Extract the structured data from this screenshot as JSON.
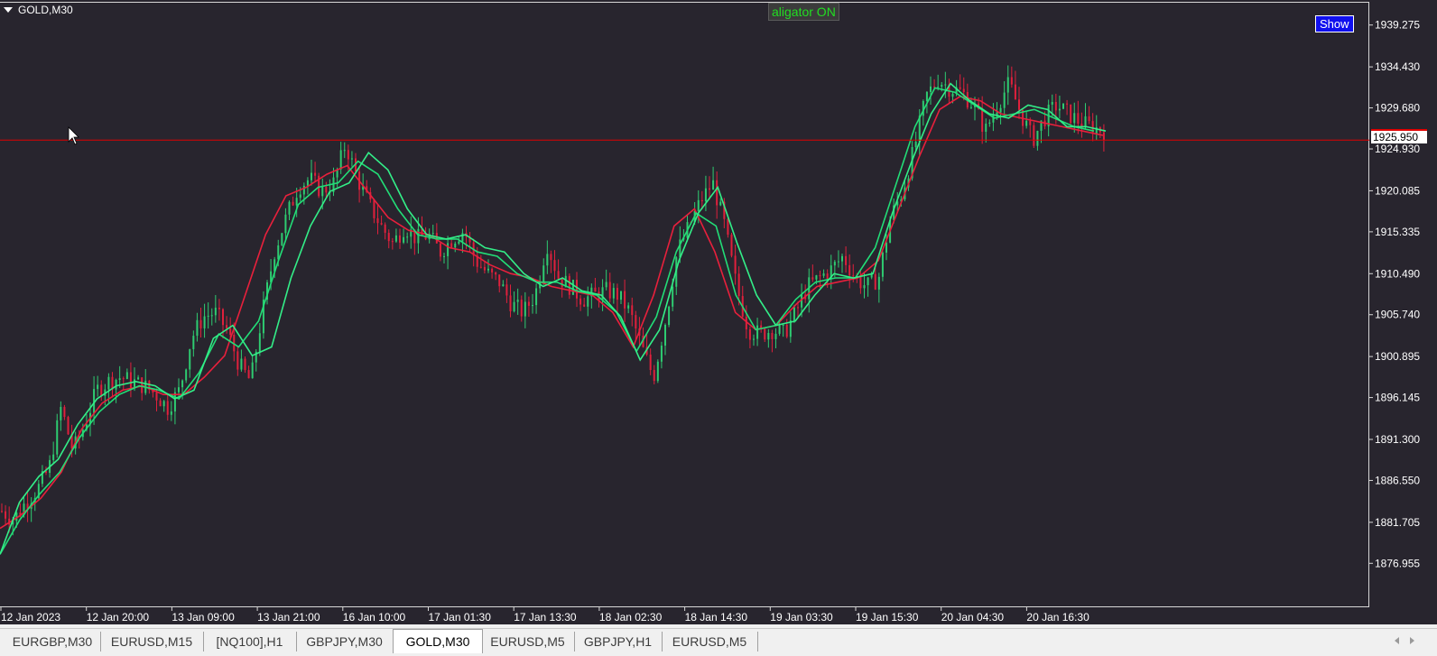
{
  "chart": {
    "symbol": "GOLD,M30",
    "indicator_label": "aligator ON",
    "show_button": "Show",
    "current_price": "1925.950",
    "price_axis": [
      "1939.275",
      "1934.430",
      "1929.680",
      "1924.930",
      "1920.085",
      "1915.335",
      "1910.490",
      "1905.740",
      "1900.895",
      "1896.145",
      "1891.300",
      "1886.550",
      "1881.705",
      "1876.955"
    ],
    "time_axis": [
      "12 Jan 2023",
      "12 Jan 20:00",
      "13 Jan 09:00",
      "13 Jan 21:00",
      "16 Jan 10:00",
      "17 Jan 01:30",
      "17 Jan 13:30",
      "18 Jan 02:30",
      "18 Jan 14:30",
      "19 Jan 03:30",
      "19 Jan 15:30",
      "20 Jan 04:30",
      "20 Jan 16:30"
    ],
    "colors": {
      "background": "#28252e",
      "bull": "#2ecc71",
      "bear": "#e0203c",
      "lips": "#33ee88",
      "teeth": "#22dd77",
      "jaw": "#e8203c",
      "price_line": "#e00000",
      "axis_text": "#ffffff"
    }
  },
  "chart_data": {
    "type": "line",
    "title": "",
    "ylim": [
      1875.0,
      1940.5
    ],
    "price_series": [
      1883.0,
      1882.0,
      1884.0,
      1885.5,
      1888.0,
      1895.0,
      1890.0,
      1893.0,
      1897.0,
      1898.0,
      1898.5,
      1898.0,
      1897.5,
      1896.5,
      1895.0,
      1897.0,
      1903.0,
      1905.5,
      1906.0,
      1904.0,
      1900.0,
      1898.0,
      1906.0,
      1913.0,
      1917.0,
      1920.5,
      1921.5,
      1920.0,
      1921.0,
      1925.5,
      1921.5,
      1918.5,
      1916.0,
      1914.0,
      1916.0,
      1914.5,
      1915.0,
      1913.0,
      1914.5,
      1915.5,
      1912.0,
      1910.5,
      1909.5,
      1907.0,
      1906.0,
      1908.0,
      1914.0,
      1910.0,
      1909.0,
      1907.5,
      1908.0,
      1908.5,
      1908.0,
      1906.0,
      1902.0,
      1898.5,
      1905.0,
      1913.0,
      1916.0,
      1919.0,
      1921.0,
      1916.0,
      1909.0,
      1904.0,
      1903.5,
      1904.0,
      1903.5,
      1906.0,
      1909.0,
      1910.0,
      1911.0,
      1912.5,
      1910.0,
      1909.0,
      1910.0,
      1917.0,
      1920.0,
      1925.0,
      1931.0,
      1933.0,
      1932.0,
      1931.5,
      1930.0,
      1927.0,
      1930.0,
      1932.5,
      1929.0,
      1926.0,
      1928.5,
      1930.0,
      1929.0,
      1928.0,
      1927.5,
      1927.0
    ],
    "lips": [
      1878.0,
      1884.0,
      1887.0,
      1889.0,
      1893.0,
      1896.0,
      1897.5,
      1898.0,
      1897.5,
      1896.0,
      1897.0,
      1903.0,
      1904.5,
      1901.0,
      1902.0,
      1910.0,
      1916.0,
      1920.0,
      1921.0,
      1924.5,
      1922.5,
      1918.0,
      1915.0,
      1914.5,
      1915.0,
      1913.5,
      1913.0,
      1910.5,
      1909.0,
      1910.0,
      1908.5,
      1908.0,
      1905.5,
      1900.5,
      1904.0,
      1912.0,
      1917.5,
      1920.5,
      1914.0,
      1908.0,
      1904.5,
      1905.0,
      1908.0,
      1910.5,
      1910.0,
      1910.5,
      1917.5,
      1923.5,
      1929.0,
      1932.5,
      1930.5,
      1929.0,
      1928.5,
      1930.0,
      1929.5,
      1927.5,
      1927.5,
      1927.0
    ],
    "teeth": [
      1878.0,
      1882.0,
      1885.0,
      1887.5,
      1891.5,
      1894.5,
      1896.5,
      1897.5,
      1897.0,
      1896.0,
      1899.0,
      1903.5,
      1902.0,
      1905.0,
      1912.0,
      1918.5,
      1920.5,
      1921.0,
      1923.5,
      1922.0,
      1918.0,
      1915.0,
      1914.5,
      1914.5,
      1913.0,
      1912.5,
      1910.5,
      1909.5,
      1909.5,
      1908.5,
      1908.0,
      1906.0,
      1901.5,
      1905.5,
      1913.0,
      1917.5,
      1916.0,
      1908.0,
      1904.0,
      1904.5,
      1907.5,
      1909.5,
      1910.0,
      1910.0,
      1913.5,
      1920.5,
      1927.5,
      1932.0,
      1931.5,
      1930.0,
      1928.5,
      1929.0,
      1929.5,
      1928.5,
      1927.5,
      1927.0
    ],
    "jaw": [
      1881.0,
      1882.5,
      1884.5,
      1887.5,
      1892.5,
      1895.5,
      1897.0,
      1897.5,
      1896.5,
      1896.5,
      1898.5,
      1901.0,
      1908.0,
      1915.0,
      1919.5,
      1920.5,
      1922.0,
      1923.0,
      1920.0,
      1917.0,
      1915.5,
      1915.0,
      1913.5,
      1913.0,
      1911.5,
      1910.5,
      1910.0,
      1909.0,
      1908.5,
      1908.0,
      1906.0,
      1902.0,
      1908.0,
      1916.0,
      1918.0,
      1913.0,
      1906.0,
      1904.0,
      1904.5,
      1907.0,
      1909.0,
      1909.5,
      1910.0,
      1912.0,
      1918.0,
      1924.0,
      1929.5,
      1931.0,
      1930.5,
      1929.0,
      1928.5,
      1928.0,
      1927.5,
      1927.0,
      1926.5
    ]
  },
  "tabs": [
    {
      "label": "EURGBP,M30",
      "active": false
    },
    {
      "label": "EURUSD,M15",
      "active": false
    },
    {
      "label": "[NQ100],H1",
      "active": false
    },
    {
      "label": "GBPJPY,M30",
      "active": false
    },
    {
      "label": "GOLD,M30",
      "active": true
    },
    {
      "label": "EURUSD,M5",
      "active": false
    },
    {
      "label": "GBPJPY,H1",
      "active": false
    },
    {
      "label": "EURUSD,M5",
      "active": false
    }
  ]
}
